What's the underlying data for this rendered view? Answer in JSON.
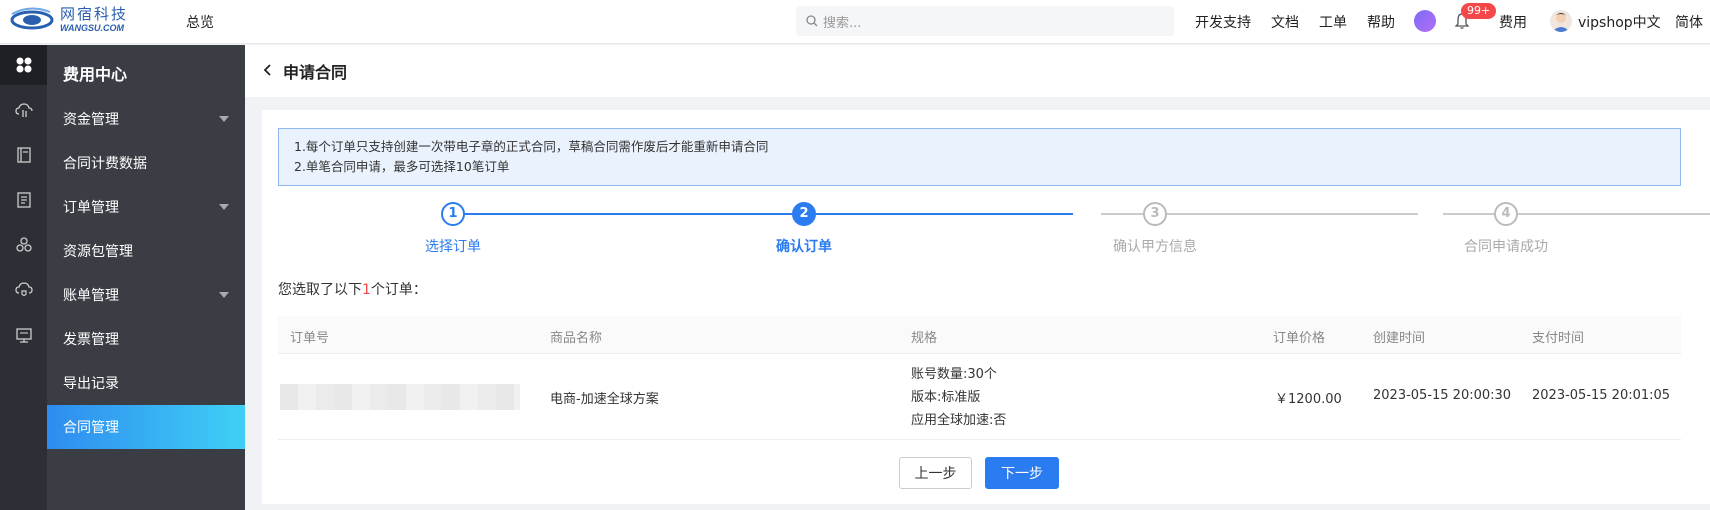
{
  "header": {
    "logo_cn": "网宿科技",
    "logo_en": "WANGSU.COM",
    "overview": "总览",
    "search_placeholder": "搜索...",
    "links": [
      "开发支持",
      "文档",
      "工单",
      "帮助"
    ],
    "notification_badge": "99+",
    "fee": "费用",
    "username": "vipshop中文",
    "language": "简体"
  },
  "rail_icons": [
    "apps-icon",
    "cloud-icon",
    "book-icon",
    "list-icon",
    "cluster-icon",
    "cloud-shield-icon",
    "monitor-icon"
  ],
  "sidebar": {
    "title": "费用中心",
    "items": [
      {
        "label": "资金管理",
        "expandable": true
      },
      {
        "label": "合同计费数据",
        "expandable": false
      },
      {
        "label": "订单管理",
        "expandable": true
      },
      {
        "label": "资源包管理",
        "expandable": false
      },
      {
        "label": "账单管理",
        "expandable": true
      },
      {
        "label": "发票管理",
        "expandable": false
      },
      {
        "label": "导出记录",
        "expandable": false
      },
      {
        "label": "合同管理",
        "expandable": false,
        "active": true
      }
    ]
  },
  "page": {
    "title": "申请合同",
    "notice_lines": [
      "1.每个订单只支持创建一次带电子章的正式合同，草稿合同需作废后才能重新申请合同",
      "2.单笔合同申请，最多可选择10笔订单"
    ],
    "steps": [
      {
        "num": "1",
        "label": "选择订单",
        "state": "done"
      },
      {
        "num": "2",
        "label": "确认订单",
        "state": "current"
      },
      {
        "num": "3",
        "label": "确认甲方信息",
        "state": "pending"
      },
      {
        "num": "4",
        "label": "合同申请成功",
        "state": "pending"
      }
    ],
    "selected_prefix": "您选取了以下",
    "selected_count": "1",
    "selected_suffix": "个订单：",
    "table": {
      "columns": [
        "订单号",
        "商品名称",
        "规格",
        "订单价格",
        "创建时间",
        "支付时间"
      ],
      "rows": [
        {
          "order_no": "",
          "product": "电商-加速全球方案",
          "spec": [
            "账号数量:30个",
            "版本:标准版",
            "应用全球加速:否"
          ],
          "price": "￥1200.00",
          "created": "2023-05-15 20:00:30",
          "paid": "2023-05-15 20:01:05"
        }
      ]
    },
    "prev_button": "上一步",
    "next_button": "下一步"
  },
  "colors": {
    "primary": "#2b7cf0",
    "rail_bg": "#2c2f36",
    "sidebar_bg": "#3a3d44",
    "badge": "#f5484a",
    "pending": "#bbbbbb"
  }
}
